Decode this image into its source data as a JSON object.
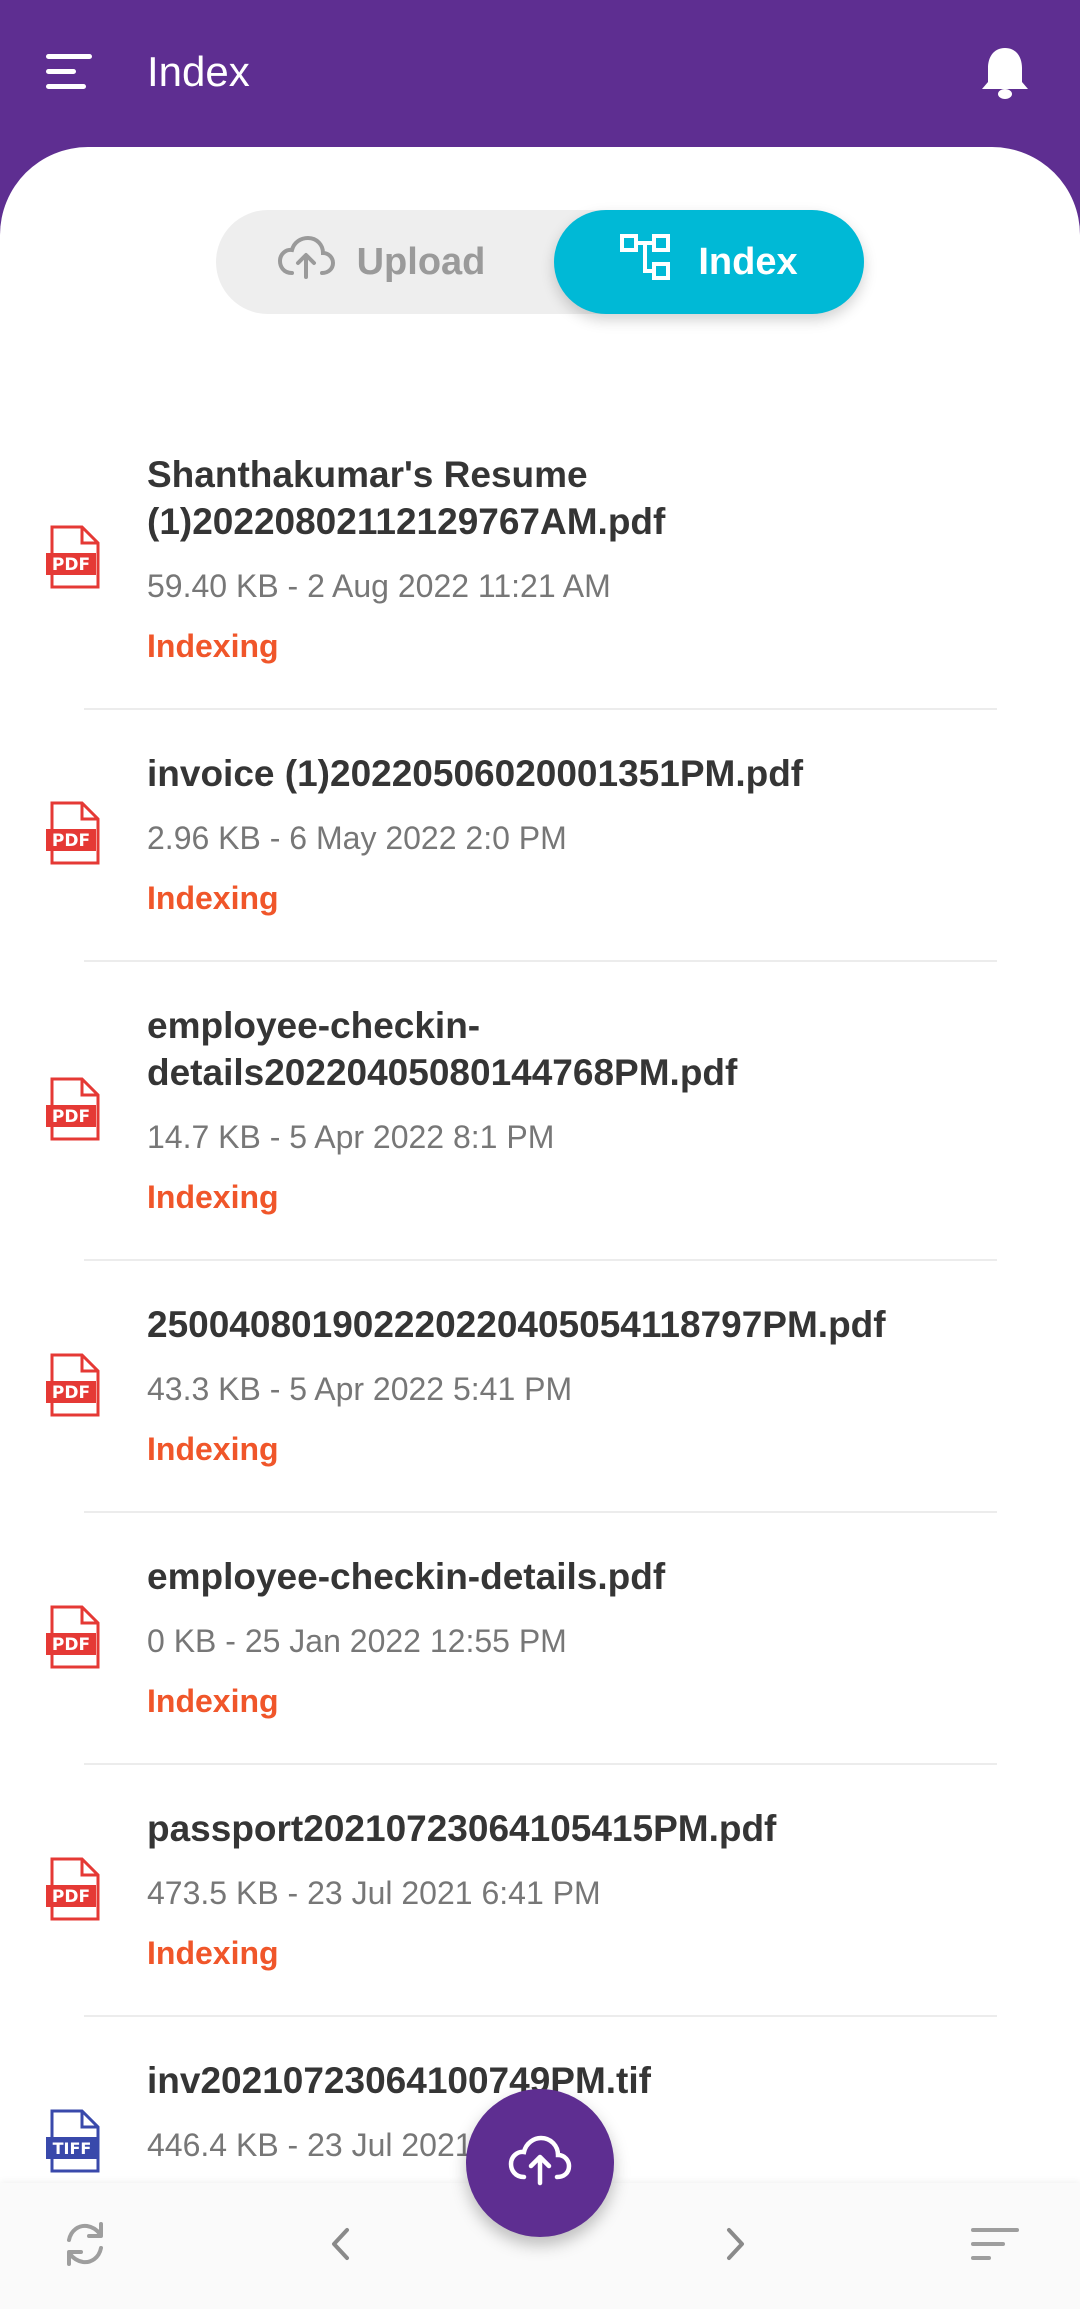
{
  "app": {
    "title": "Index",
    "icons": {
      "menu": "menu-icon",
      "notifications": "bell-icon"
    },
    "colors": {
      "primary": "#5e2e91",
      "accent": "#00b9d6",
      "status": "#f0562a",
      "pdf": "#e53935",
      "tiff": "#3949ab"
    }
  },
  "segmented": {
    "upload_label": "Upload",
    "index_label": "Index",
    "selected": "Index"
  },
  "files": [
    {
      "icon": "pdf-icon",
      "name_line1": "Shanthakumar's Resume",
      "name_line2": "(1)20220802112129767AM.pdf",
      "meta": "59.40 KB - 2 Aug 2022 11:21 AM",
      "status": "Indexing"
    },
    {
      "icon": "pdf-icon",
      "name_line1": "invoice (1)20220506020001351PM.pdf",
      "meta": "2.96 KB - 6 May 2022 2:0 PM",
      "status": "Indexing"
    },
    {
      "icon": "pdf-icon",
      "name_line1": "employee-checkin-",
      "name_line2": "details20220405080144768PM.pdf",
      "meta": "14.7 KB - 5 Apr 2022 8:1 PM",
      "status": "Indexing"
    },
    {
      "icon": "pdf-icon",
      "name_line1": "25004080190222022040505411879​7PM.pdf",
      "meta": "43.3 KB - 5 Apr 2022 5:41 PM",
      "status": "Indexing"
    },
    {
      "icon": "pdf-icon",
      "name_line1": "employee-checkin-details.pdf",
      "meta": "0 KB - 25 Jan 2022 12:55 PM",
      "status": "Indexing"
    },
    {
      "icon": "pdf-icon",
      "name_line1": "passport20210723064105415PM.pdf",
      "meta": "473.5 KB - 23 Jul 2021 6:41 PM",
      "status": "Indexing"
    },
    {
      "icon": "tiff-icon",
      "name_line1": "inv20210723064100749PM.tif",
      "meta": "446.4 KB - 23 Jul 2021 6:41 PM",
      "status": ""
    }
  ],
  "bottom_bar": {
    "refresh": "refresh-icon",
    "prev": "chevron-left-icon",
    "upload": "cloud-upload-icon",
    "next": "chevron-right-icon",
    "sort": "sort-icon"
  }
}
